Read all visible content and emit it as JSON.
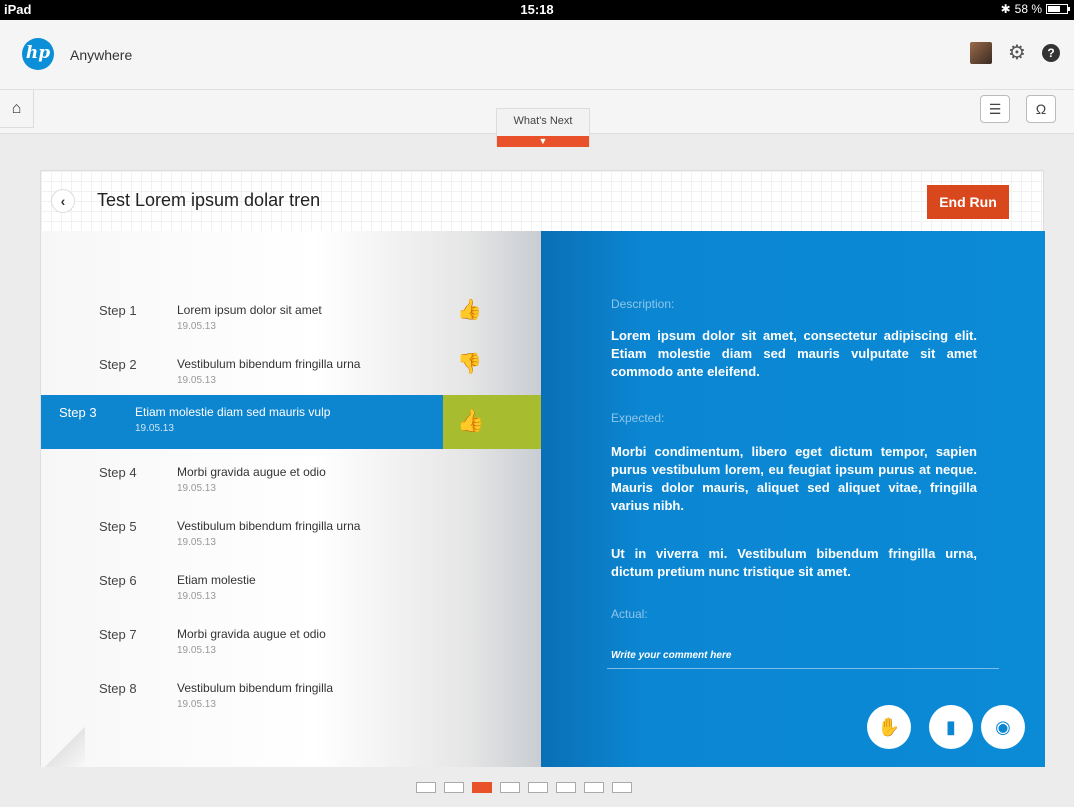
{
  "statusbar": {
    "device": "iPad",
    "time": "15:18",
    "battery": "58 %",
    "battery_level": 0.58,
    "bluetooth_icon": "bluetooth-icon"
  },
  "header": {
    "logo": "hp",
    "app_name": "Anywhere"
  },
  "toolbar": {
    "whats_next": "What's Next",
    "whats_next_arrow": "⌄"
  },
  "card": {
    "title": "Test Lorem ipsum dolar tren",
    "end_run": "End Run",
    "back": "‹"
  },
  "steps": [
    {
      "num": "Step 1",
      "title": "Lorem ipsum dolor sit amet",
      "date": "19.05.13",
      "result": "up"
    },
    {
      "num": "Step 2",
      "title": "Vestibulum bibendum fringilla urna",
      "date": "19.05.13",
      "result": "down"
    },
    {
      "num": "Step 3",
      "title": "Etiam molestie diam sed mauris vulp",
      "date": "19.05.13",
      "result": "up"
    },
    {
      "num": "Step 4",
      "title": "Morbi gravida augue et odio",
      "date": "19.05.13",
      "result": ""
    },
    {
      "num": "Step 5",
      "title": "Vestibulum bibendum fringilla urna",
      "date": "19.05.13",
      "result": ""
    },
    {
      "num": "Step 6",
      "title": "Etiam molestie",
      "date": "19.05.13",
      "result": ""
    },
    {
      "num": "Step 7",
      "title": "Morbi gravida augue et odio",
      "date": "19.05.13",
      "result": ""
    },
    {
      "num": "Step 8",
      "title": "Vestibulum bibendum fringilla",
      "date": "19.05.13",
      "result": ""
    }
  ],
  "detail": {
    "description_label": "Description:",
    "description": "Lorem ipsum dolor sit amet, consectetur adipiscing elit. Etiam molestie diam sed mauris vulputate sit amet commodo ante eleifend.",
    "expected_label": "Expected:",
    "expected_1": "Morbi condimentum, libero eget dictum tempor, sapien purus vestibulum lorem, eu feugiat ipsum purus at neque. Mauris dolor mauris, aliquet sed aliquet vitae, fringilla varius nibh.",
    "expected_2": "Ut in viverra mi. Vestibulum bibendum fringilla urna, dictum pretium nunc tristique sit amet.",
    "actual_label": "Actual:",
    "comment_placeholder": "Write your comment here"
  },
  "pager": {
    "count": 8,
    "active": 3
  },
  "colors": {
    "accent": "#e8512a",
    "blue": "#0b86d2",
    "green": "#8cb833",
    "red": "#e0451c"
  }
}
